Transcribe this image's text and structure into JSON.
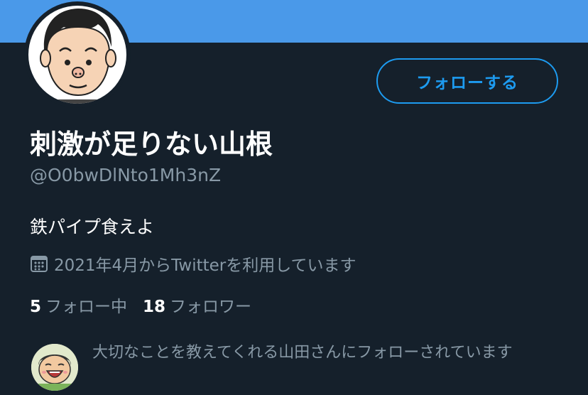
{
  "profile": {
    "display_name": "刺激が足りない山根",
    "handle": "@O0bwDlNto1Mh3nZ",
    "bio": "鉄パイプ食えよ",
    "joined": "2021年4月からTwitterを利用しています",
    "avatar_icon": "cartoon-face-avatar"
  },
  "actions": {
    "follow_label": "フォローする"
  },
  "stats": {
    "following_count": "5",
    "following_label": "フォロー中",
    "followers_count": "18",
    "followers_label": "フォロワー"
  },
  "followed_by": {
    "text": "大切なことを教えてくれる山田さんにフォローされています",
    "avatar_icon": "smiling-cartoon-avatar"
  },
  "colors": {
    "banner": "#4a99e9",
    "background": "#15202b",
    "accent": "#1d9bf0",
    "secondary_text": "#8899a6"
  }
}
